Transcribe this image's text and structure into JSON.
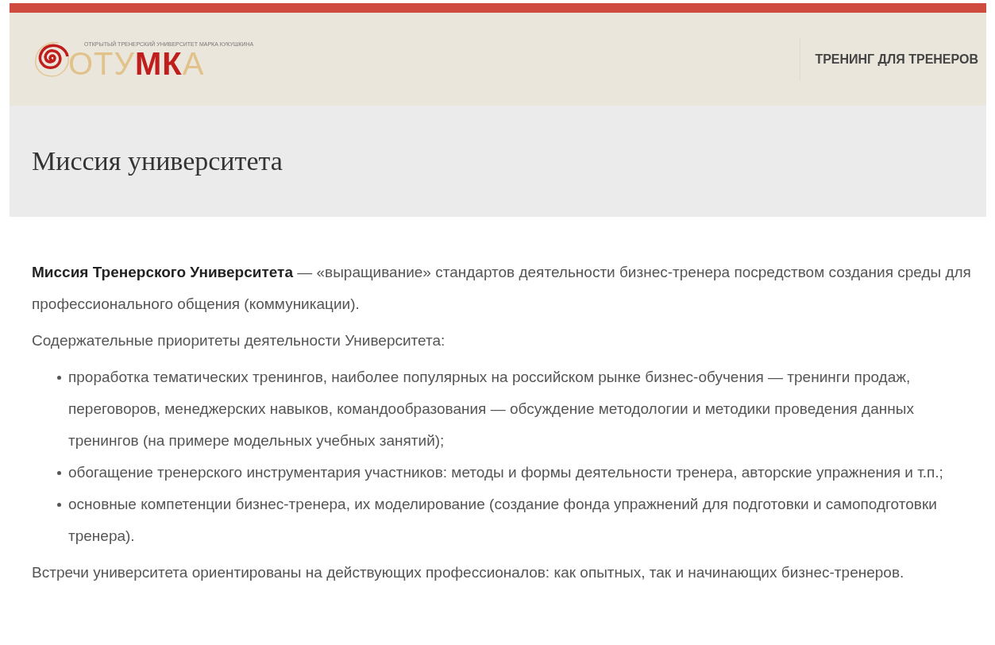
{
  "header": {
    "logo": {
      "tagline": "ОТКРЫТЫЙ ТРЕНЕРСКИЙ УНИВЕРСИТЕТ МАРКА КУКУШКИНА",
      "parts": [
        {
          "text": "ОТУ",
          "accent": false
        },
        {
          "text": "МК",
          "accent": true
        },
        {
          "text": "А",
          "accent": false
        }
      ]
    },
    "nav": [
      {
        "label": "ТРЕНИНГ ДЛЯ ТРЕНЕРОВ"
      }
    ]
  },
  "page_title": "Миссия университета",
  "content": [
    {
      "kind": "paragraph",
      "text": "**Миссия Тренерского Университета** — «выращивание» стандартов деятельности бизнес-тренера посредством создания среды для профессионального общения (коммуникации)."
    },
    {
      "kind": "paragraph",
      "text": "Содержательные приоритеты деятельности Университета:"
    },
    {
      "kind": "list",
      "items": [
        "проработка тематических тренингов, наиболее популярных на российском рынке бизнес-обучения — тренинги продаж, переговоров, менеджерских навыков, командообразования — обсуждение методологии и методики проведения данных тренингов (на примере модельных учебных занятий);",
        "обогащение тренерского инструментария участников: методы и формы деятельности тренера, авторские упражнения и т.п.;",
        "основные компетенции бизнес-тренера, их моделирование (создание фонда упражнений для подготовки и самоподготовки тренера)."
      ]
    },
    {
      "kind": "paragraph",
      "text": "Встречи университета ориентированы на действующих профессионалов: как опытных, так и начинающих бизнес-тренеров."
    }
  ]
}
